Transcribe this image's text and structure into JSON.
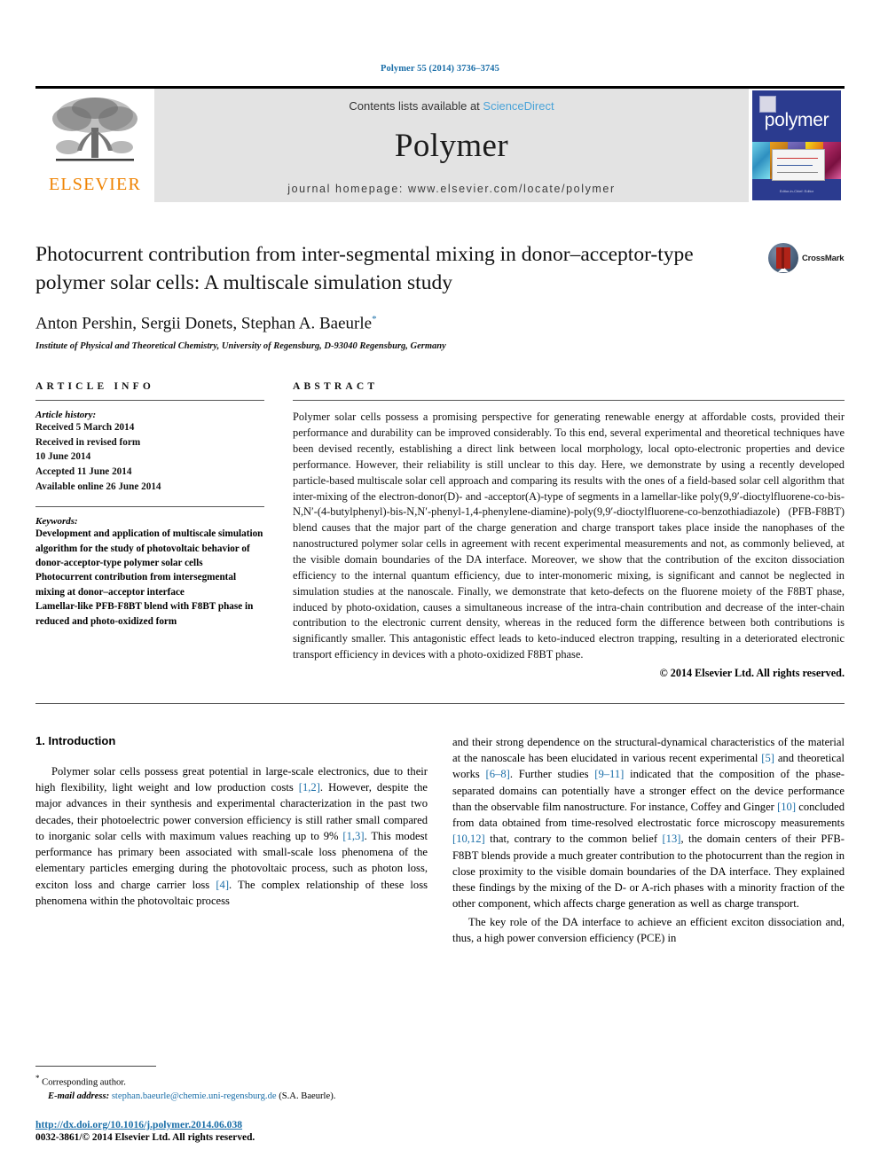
{
  "running_head": "Polymer 55 (2014) 3736–3745",
  "masthead": {
    "publisher_name": "ELSEVIER",
    "contents_prefix": "Contents lists available at ",
    "contents_link": "ScienceDirect",
    "journal_name": "Polymer",
    "homepage": "journal homepage: www.elsevier.com/locate/polymer",
    "cover_title": "polymer",
    "cover_footer": "Editor-in-Chief: Editor"
  },
  "article": {
    "title": "Photocurrent contribution from inter-segmental mixing in donor–acceptor-type polymer solar cells: A multiscale simulation study",
    "authors": "Anton Pershin, Sergii Donets, Stephan A. Baeurle",
    "author_marker": "*",
    "affiliation": "Institute of Physical and Theoretical Chemistry, University of Regensburg, D-93040 Regensburg, Germany",
    "crossmark_label": "CrossMark"
  },
  "article_info": {
    "heading": "ARTICLE INFO",
    "history_label": "Article history:",
    "history": [
      "Received 5 March 2014",
      "Received in revised form",
      "10 June 2014",
      "Accepted 11 June 2014",
      "Available online 26 June 2014"
    ],
    "keywords_label": "Keywords:",
    "keywords": [
      "Development and application of multiscale simulation algorithm for the study of photovoltaic behavior of donor-acceptor-type polymer solar cells",
      "Photocurrent contribution from intersegmental mixing at donor–acceptor interface",
      "Lamellar-like PFB-F8BT blend with F8BT phase in reduced and photo-oxidized form"
    ]
  },
  "abstract": {
    "heading": "ABSTRACT",
    "text": "Polymer solar cells possess a promising perspective for generating renewable energy at affordable costs, provided their performance and durability can be improved considerably. To this end, several experimental and theoretical techniques have been devised recently, establishing a direct link between local morphology, local opto-electronic properties and device performance. However, their reliability is still unclear to this day. Here, we demonstrate by using a recently developed particle-based multiscale solar cell approach and comparing its results with the ones of a field-based solar cell algorithm that inter-mixing of the electron-donor(D)- and -acceptor(A)-type of segments in a lamellar-like poly(9,9′-dioctylfluorene-co-bis-N,N′-(4-butylphenyl)-bis-N,N′-phenyl-1,4-phenylene-diamine)-poly(9,9′-dioctylfluorene-co-benzothiadiazole) (PFB-F8BT) blend causes that the major part of the charge generation and charge transport takes place inside the nanophases of the nanostructured polymer solar cells in agreement with recent experimental measurements and not, as commonly believed, at the visible domain boundaries of the DA interface. Moreover, we show that the contribution of the exciton dissociation efficiency to the internal quantum efficiency, due to inter-monomeric mixing, is significant and cannot be neglected in simulation studies at the nanoscale. Finally, we demonstrate that keto-defects on the fluorene moiety of the F8BT phase, induced by photo-oxidation, causes a simultaneous increase of the intra-chain contribution and decrease of the inter-chain contribution to the electronic current density, whereas in the reduced form the difference between both contributions is significantly smaller. This antagonistic effect leads to keto-induced electron trapping, resulting in a deteriorated electronic transport efficiency in devices with a photo-oxidized F8BT phase.",
    "copyright": "© 2014 Elsevier Ltd. All rights reserved."
  },
  "introduction": {
    "section_title": "1. Introduction",
    "left_para_1_a": "Polymer solar cells possess great potential in large-scale electronics, due to their high flexibility, light weight and low production costs ",
    "left_ref_1": "[1,2]",
    "left_para_1_b": ". However, despite the major advances in their synthesis and experimental characterization in the past two decades, their photoelectric power conversion efficiency is still rather small compared to inorganic solar cells with maximum values reaching up to 9% ",
    "left_ref_2": "[1,3]",
    "left_para_1_c": ". This modest performance has primary been associated with small-scale loss phenomena of the elementary particles emerging during the photovoltaic process, such as photon loss, exciton loss and charge carrier loss ",
    "left_ref_3": "[4]",
    "left_para_1_d": ". The complex relationship of these loss phenomena within the photovoltaic process",
    "right_para_1_a": "and their strong dependence on the structural-dynamical characteristics of the material at the nanoscale has been elucidated in various recent experimental ",
    "right_ref_1": "[5]",
    "right_para_1_b": " and theoretical works ",
    "right_ref_2": "[6–8]",
    "right_para_1_c": ". Further studies ",
    "right_ref_3": "[9–11]",
    "right_para_1_d": " indicated that the composition of the phase-separated domains can potentially have a stronger effect on the device performance than the observable film nanostructure. For instance, Coffey and Ginger ",
    "right_ref_4": "[10]",
    "right_para_1_e": " concluded from data obtained from time-resolved electrostatic force microscopy measurements ",
    "right_ref_5": "[10,12]",
    "right_para_1_f": " that, contrary to the common belief ",
    "right_ref_6": "[13]",
    "right_para_1_g": ", the domain centers of their PFB-F8BT blends provide a much greater contribution to the photocurrent than the region in close proximity to the visible domain boundaries of the DA interface. They explained these findings by the mixing of the D- or A-rich phases with a minority fraction of the other component, which affects charge generation as well as charge transport.",
    "right_para_2": "The key role of the DA interface to achieve an efficient exciton dissociation and, thus, a high power conversion efficiency (PCE) in"
  },
  "footnote": {
    "corresponding": "Corresponding author.",
    "email_label": "E-mail address:",
    "email": "stephan.baeurle@chemie.uni-regensburg.de",
    "email_suffix": "(S.A. Baeurle).",
    "doi": "http://dx.doi.org/10.1016/j.polymer.2014.06.038",
    "issn": "0032-3861/© 2014 Elsevier Ltd. All rights reserved."
  },
  "colors": {
    "link_blue": "#1a6ea8",
    "sciencedirect_blue": "#4aa3d8",
    "elsevier_orange": "#ef8200",
    "cover_blue": "#2b3b8f"
  }
}
